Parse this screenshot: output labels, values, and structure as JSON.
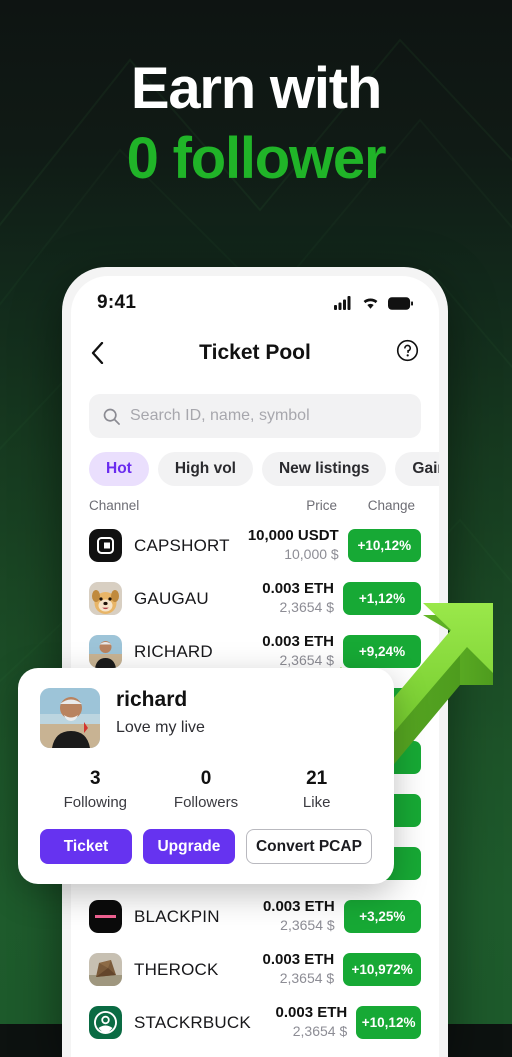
{
  "promo": {
    "line1": "Earn with",
    "line2": "0 follower",
    "line1_color": "#ffffff",
    "line2_color": "#20b428",
    "background_color": "#1d5a2b"
  },
  "phone": {
    "status_bar": {
      "time": "9:41",
      "icons": [
        "signal-icon",
        "wifi-icon",
        "battery-icon"
      ]
    },
    "nav": {
      "back_icon": "chevron-left-icon",
      "title": "Ticket Pool",
      "help_icon": "question-circle-icon"
    },
    "search": {
      "icon": "search-icon",
      "placeholder": "Search ID, name, symbol",
      "value": ""
    },
    "filters": {
      "active": "Hot",
      "active_bg": "#eadffd",
      "active_color": "#6a2bef",
      "chips": [
        {
          "label": "Hot"
        },
        {
          "label": "High vol"
        },
        {
          "label": "New listings"
        },
        {
          "label": "Gainers"
        }
      ]
    },
    "columns": {
      "channel": "Channel",
      "price": "Price",
      "change": "Change"
    },
    "badge_color": "#17a935",
    "rows": [
      {
        "name": "CAPSHORT",
        "price": "10,000 USDT",
        "price_usd": "10,000 $",
        "change": "+10,12%",
        "avatar": "capshort-avatar"
      },
      {
        "name": "GAUGAU",
        "price": "0.003 ETH",
        "price_usd": "2,3654 $",
        "change": "+1,12%",
        "avatar": "gaugau-avatar"
      },
      {
        "name": "RICHARD",
        "price": "0.003 ETH",
        "price_usd": "2,3654 $",
        "change": "+9,24%",
        "avatar": "richard-avatar"
      },
      {
        "name": "BLACKPIN",
        "price": "0.003 ETH",
        "price_usd": "2,3654 $",
        "change": "+3,25%",
        "avatar": "blackpin-avatar"
      },
      {
        "name": "THEROCK",
        "price": "0.003 ETH",
        "price_usd": "2,3654 $",
        "change": "+10,972%",
        "avatar": "therock-avatar"
      },
      {
        "name": "STACKRBUCK",
        "price": "0.003 ETH",
        "price_usd": "2,3654 $",
        "change": "+10,12%",
        "avatar": "stackrbuck-avatar"
      }
    ]
  },
  "profile_card": {
    "username": "richard",
    "bio": "Love my live",
    "avatar": "richard-avatar",
    "stats": [
      {
        "value": "3",
        "label": "Following"
      },
      {
        "value": "0",
        "label": "Followers"
      },
      {
        "value": "21",
        "label": "Like"
      }
    ],
    "buttons": [
      {
        "label": "Ticket",
        "style": "primary"
      },
      {
        "label": "Upgrade",
        "style": "primary"
      },
      {
        "label": "Convert PCAP",
        "style": "outline"
      }
    ],
    "primary_color": "#6633f0"
  }
}
